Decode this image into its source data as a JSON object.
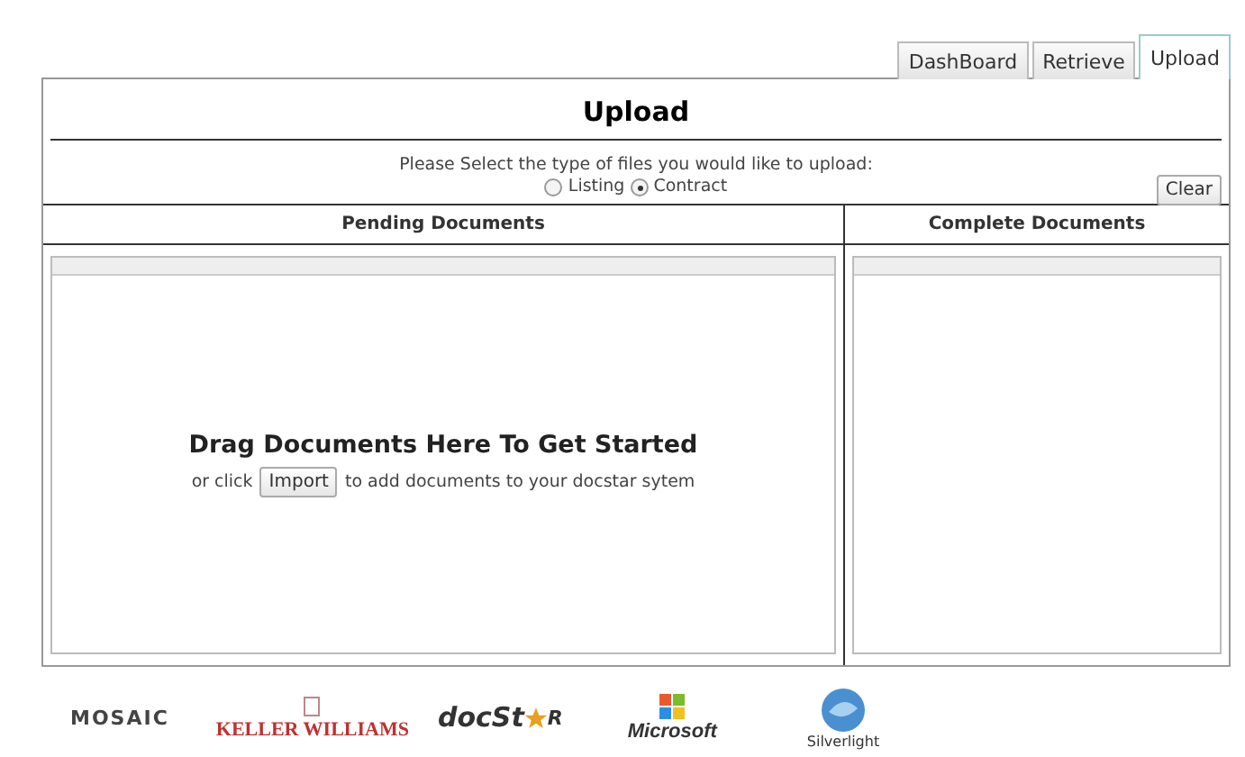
{
  "tabs": [
    {
      "label": "DashBoard",
      "selected": false
    },
    {
      "label": "Retrieve",
      "selected": false
    },
    {
      "label": "Upload",
      "selected": true
    }
  ],
  "title": "Upload",
  "prompt": "Please Select the type of files you would like to upload:",
  "file_types": [
    {
      "label": "Listing",
      "selected": false
    },
    {
      "label": "Contract",
      "selected": true
    }
  ],
  "clear_button": "Clear",
  "pending": {
    "heading": "Pending Documents",
    "drop_title": "Drag Documents Here To Get Started",
    "before_button": "or click",
    "import_button": "Import",
    "after_button": "to add documents to your docstar sytem"
  },
  "complete": {
    "heading": "Complete Documents"
  },
  "logos": [
    {
      "kind": "mosaic",
      "text": "MOSAIC"
    },
    {
      "kind": "keller",
      "text": "KELLER WILLIAMS"
    },
    {
      "kind": "docstar",
      "text": "docSt",
      "tail": "R"
    },
    {
      "kind": "microsoft",
      "text": "Microsoft"
    },
    {
      "kind": "silverlight",
      "text": "Silverlight"
    }
  ]
}
